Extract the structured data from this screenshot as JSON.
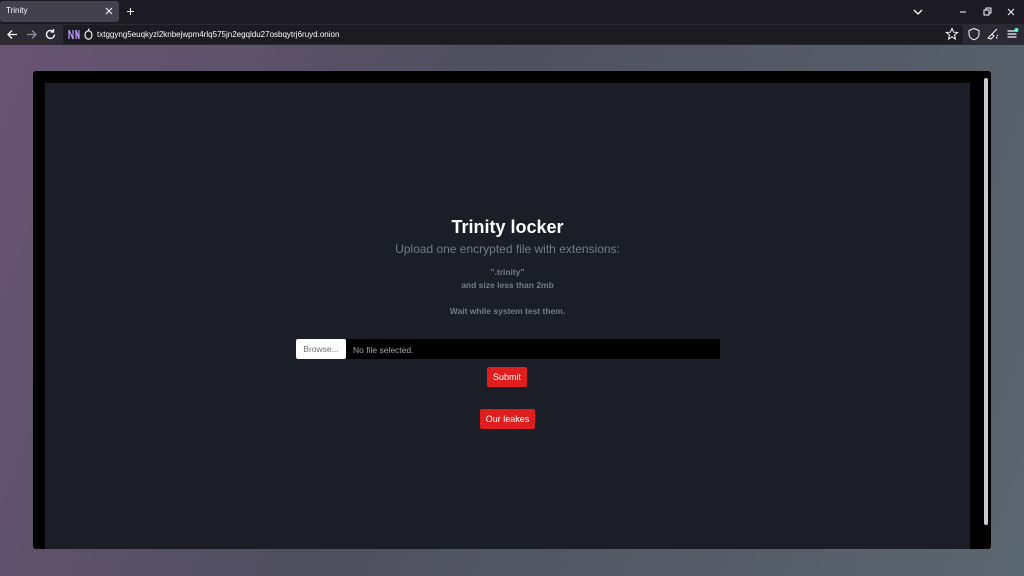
{
  "browser": {
    "tab_title": "Trinity",
    "new_tab": "+",
    "url": "txtggyng5euqkyzl2knbejwpm4rlq575jn2egqldu27osbqytrj6ruyd.onion"
  },
  "page": {
    "title": "Trinity locker",
    "subtitle": "Upload one encrypted file with extensions:",
    "extension": "\".trinity\"",
    "size_note": "and size less than 2mb",
    "wait_note": "Wait while system test them.",
    "browse_label": "Browse...",
    "file_status": "No file selected.",
    "submit_label": "Submit",
    "leaks_label": "Our leakes"
  },
  "colors": {
    "accent_red": "#e01e1e",
    "page_bg": "#1b1e26"
  }
}
